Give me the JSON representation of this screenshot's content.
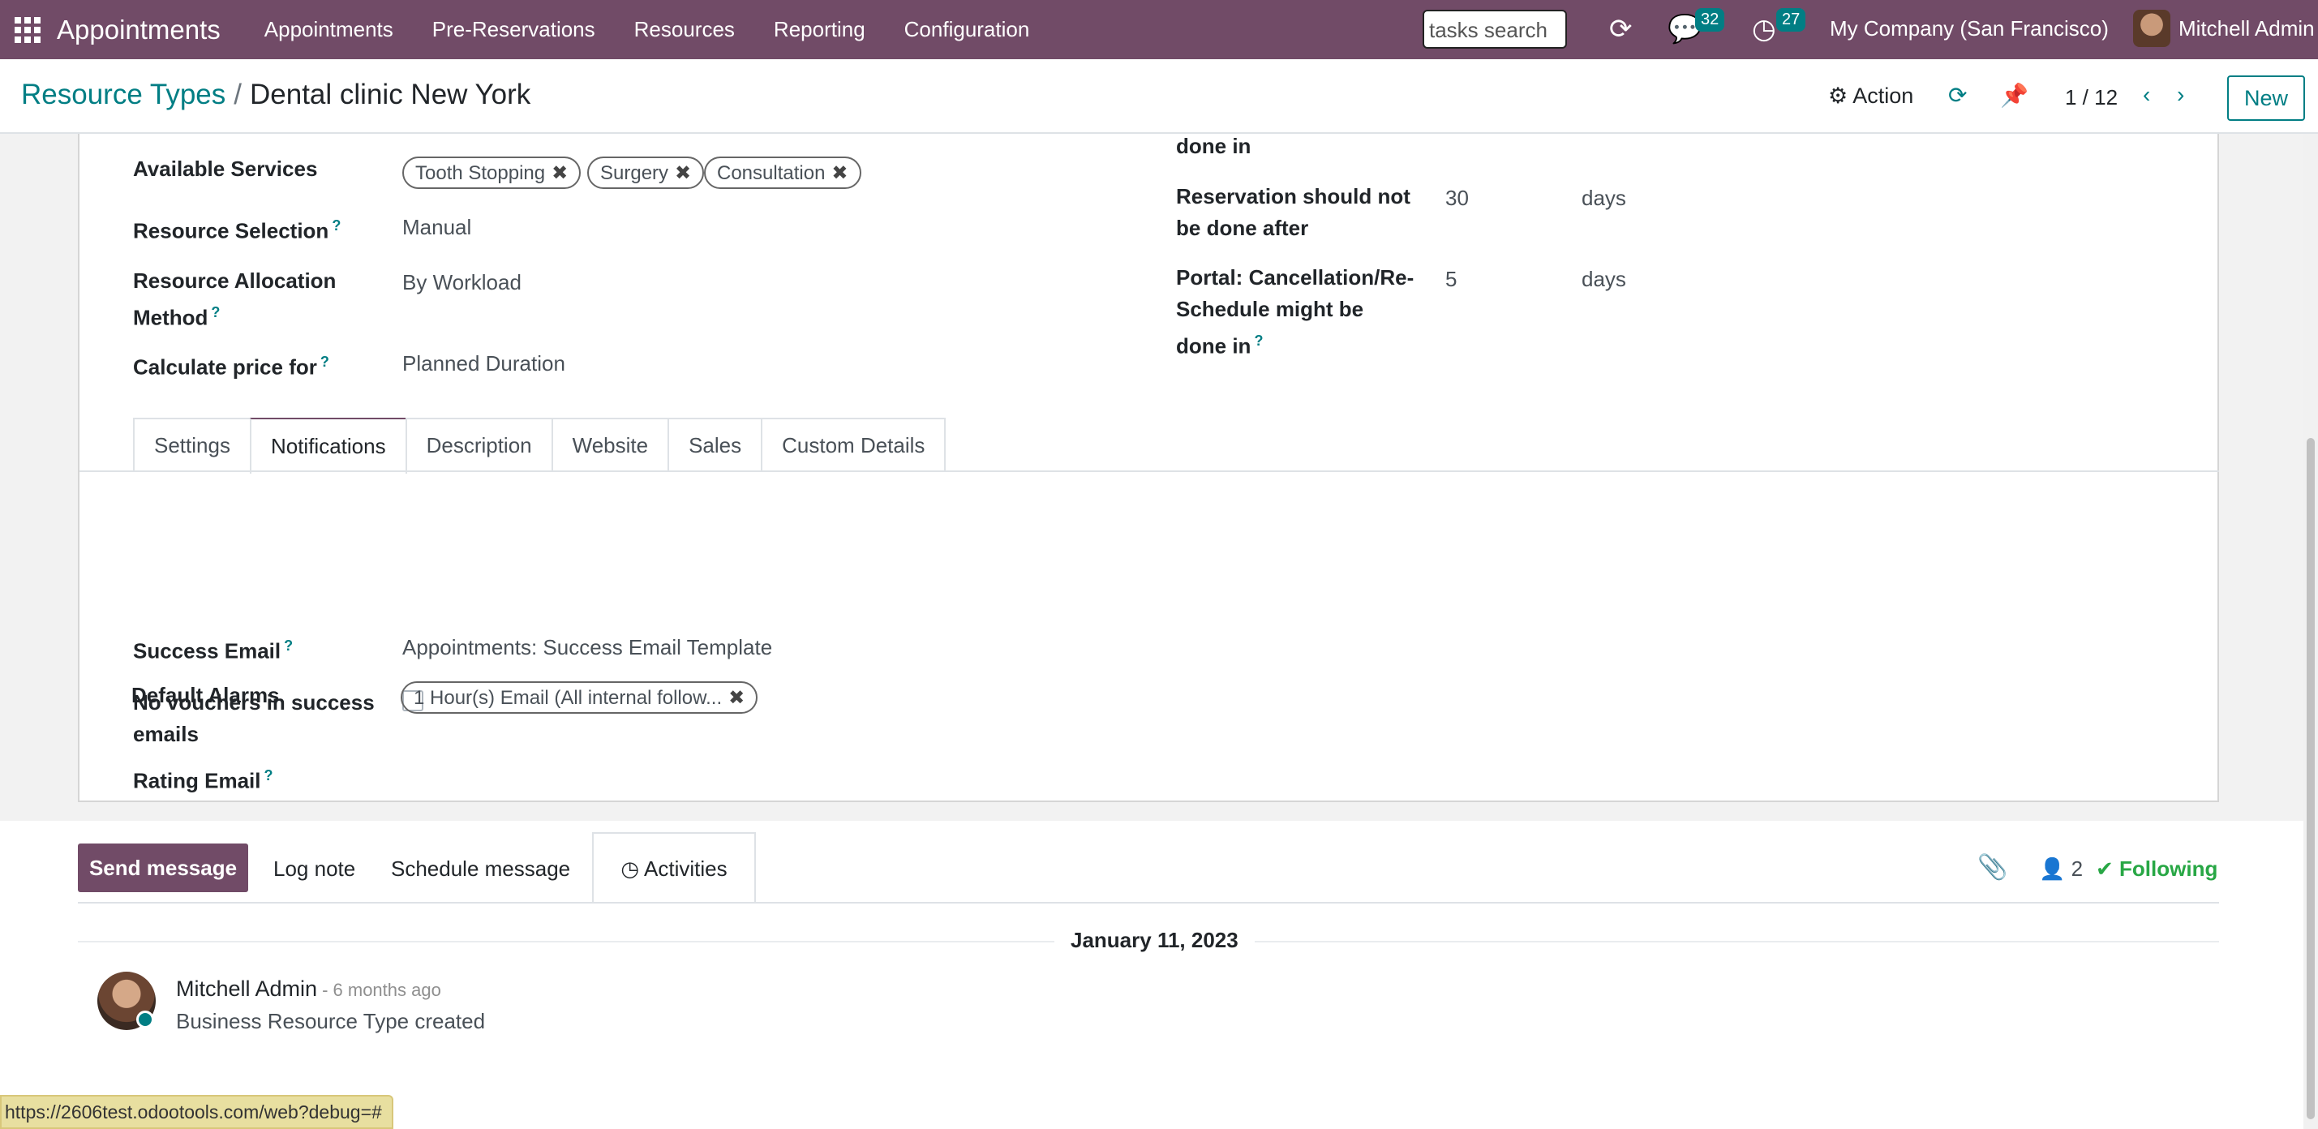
{
  "nav": {
    "brand": "Appointments",
    "menu": [
      "Appointments",
      "Pre-Reservations",
      "Resources",
      "Reporting",
      "Configuration"
    ],
    "search_placeholder": "tasks search",
    "messages_count": "32",
    "activities_count": "27",
    "company": "My Company (San Francisco)",
    "user": "Mitchell Admin"
  },
  "control": {
    "breadcrumb_parent": "Resource Types",
    "breadcrumb_sep": "/",
    "record_title": "Dental clinic New York",
    "action_label": "Action",
    "pager": "1 / 12",
    "new_label": "New"
  },
  "form": {
    "left": [
      {
        "label": "Available Services",
        "value": ""
      },
      {
        "label": "Resource Selection",
        "value": "Manual"
      },
      {
        "label": "Resource Allocation Method",
        "value": "By Workload"
      },
      {
        "label": "Calculate price for",
        "value": "Planned Duration"
      }
    ],
    "services_tags": [
      "Tooth Stopping",
      "Surgery",
      "Consultation"
    ],
    "right": [
      {
        "label": "done in",
        "value": "",
        "unit": ""
      },
      {
        "label": "Reservation should not be done after",
        "value": "30",
        "unit": "days"
      },
      {
        "label": "Portal: Cancellation/Re-Schedule might be done in",
        "value": "5",
        "unit": "days"
      }
    ],
    "help_mark": "?"
  },
  "tabs": [
    "Settings",
    "Notifications",
    "Description",
    "Website",
    "Sales",
    "Custom Details"
  ],
  "active_tab": "Notifications",
  "notifications": {
    "success_email_label": "Success Email",
    "success_email_value": "Appointments: Success Email Template",
    "no_vouchers_label": "No vouchers in success emails",
    "no_vouchers_checked": false,
    "rating_email_label": "Rating Email",
    "default_alarms_label": "Default Alarms",
    "default_alarms_tag": "1 Hour(s) Email (All internal follow..."
  },
  "chatter": {
    "send_message": "Send message",
    "log_note": "Log note",
    "schedule_message": "Schedule message",
    "activities": "Activities",
    "followers_count": "2",
    "following": "Following",
    "date": "January 11, 2023",
    "message": {
      "author": "Mitchell Admin",
      "time": "- 6 months ago",
      "body": "Business Resource Type created"
    }
  },
  "status_url": "https://2606test.odootools.com/web?debug=#",
  "colors": {
    "brand": "#714b67",
    "accent": "#017e84",
    "following": "#28a745"
  }
}
